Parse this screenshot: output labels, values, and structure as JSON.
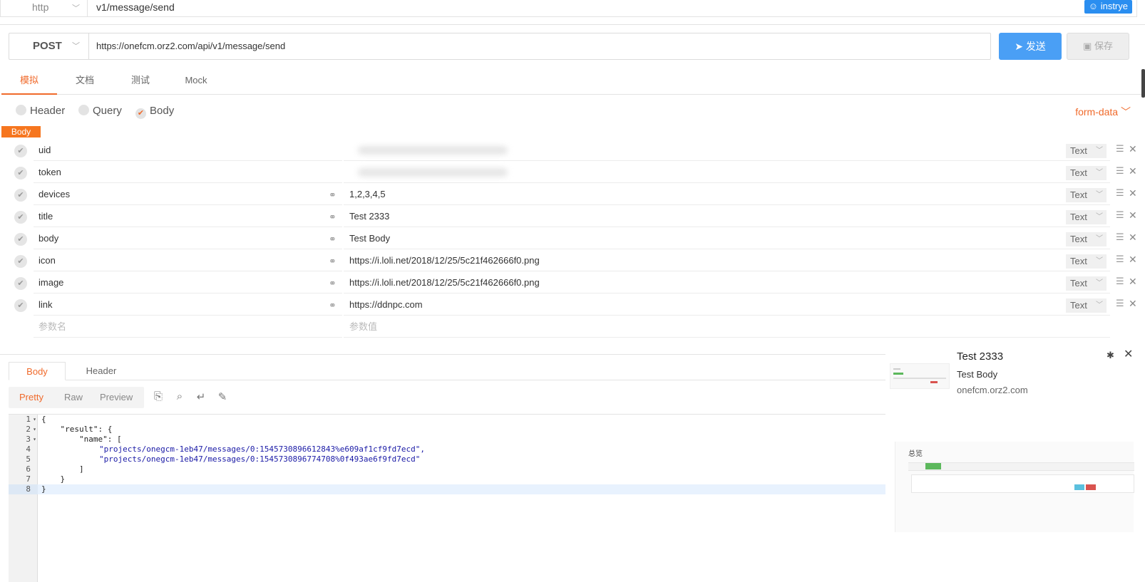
{
  "topbar": {
    "protocol": "http",
    "path": "v1/message/send",
    "user": "instrye"
  },
  "request": {
    "method": "POST",
    "url": "https://onefcm.orz2.com/api/v1/message/send",
    "send_label": "发送",
    "save_label": "保存"
  },
  "tabs": [
    "模拟",
    "文档",
    "测试",
    "Mock"
  ],
  "sections": {
    "header": "Header",
    "query": "Query",
    "body": "Body",
    "body_format": "form-data",
    "body_tag": "Body"
  },
  "params": [
    {
      "key": "uid",
      "value": "",
      "type": "Text"
    },
    {
      "key": "token",
      "value": "",
      "type": "Text"
    },
    {
      "key": "devices",
      "value": "1,2,3,4,5",
      "type": "Text"
    },
    {
      "key": "title",
      "value": "Test 2333",
      "type": "Text"
    },
    {
      "key": "body",
      "value": "Test Body",
      "type": "Text"
    },
    {
      "key": "icon",
      "value": "https://i.loli.net/2018/12/25/5c21f462666f0.png",
      "type": "Text"
    },
    {
      "key": "image",
      "value": "https://i.loli.net/2018/12/25/5c21f462666f0.png",
      "type": "Text"
    },
    {
      "key": "link",
      "value": "https://ddnpc.com",
      "type": "Text"
    }
  ],
  "new_param": {
    "key_placeholder": "参数名",
    "value_placeholder": "参数值"
  },
  "response": {
    "tabs": [
      "Body",
      "Header"
    ],
    "views": [
      "Pretty",
      "Raw",
      "Preview"
    ],
    "line_numbers": [
      "1",
      "2",
      "3",
      "4",
      "5",
      "6",
      "7",
      "8"
    ],
    "code": {
      "l1": "{",
      "l2_key": "    \"result\": {",
      "l3_key": "        \"name\": [",
      "l4": "\"projects/onegcm-1eb47/messages/0:1545730896612843%e609af1cf9fd7ecd\",",
      "l5": "\"projects/onegcm-1eb47/messages/0:1545730896774708%0f493ae6f9fd7ecd\"",
      "l6": "        ]",
      "l7": "    }",
      "l8": "}"
    }
  },
  "notification": {
    "title": "Test 2333",
    "body": "Test Body",
    "source": "onefcm.orz2.com"
  },
  "dashboard": {
    "title": "总览"
  },
  "icons": {
    "user": "user-icon",
    "send": "paper-plane-icon",
    "save": "save-icon",
    "check": "check-icon",
    "link": "link-icon",
    "menu": "menu-icon",
    "delete": "close-icon",
    "gear": "gear-icon"
  },
  "colors": {
    "accent": "#f06a2b",
    "primary": "#4a9ff5",
    "string": "#1a1aa6"
  }
}
